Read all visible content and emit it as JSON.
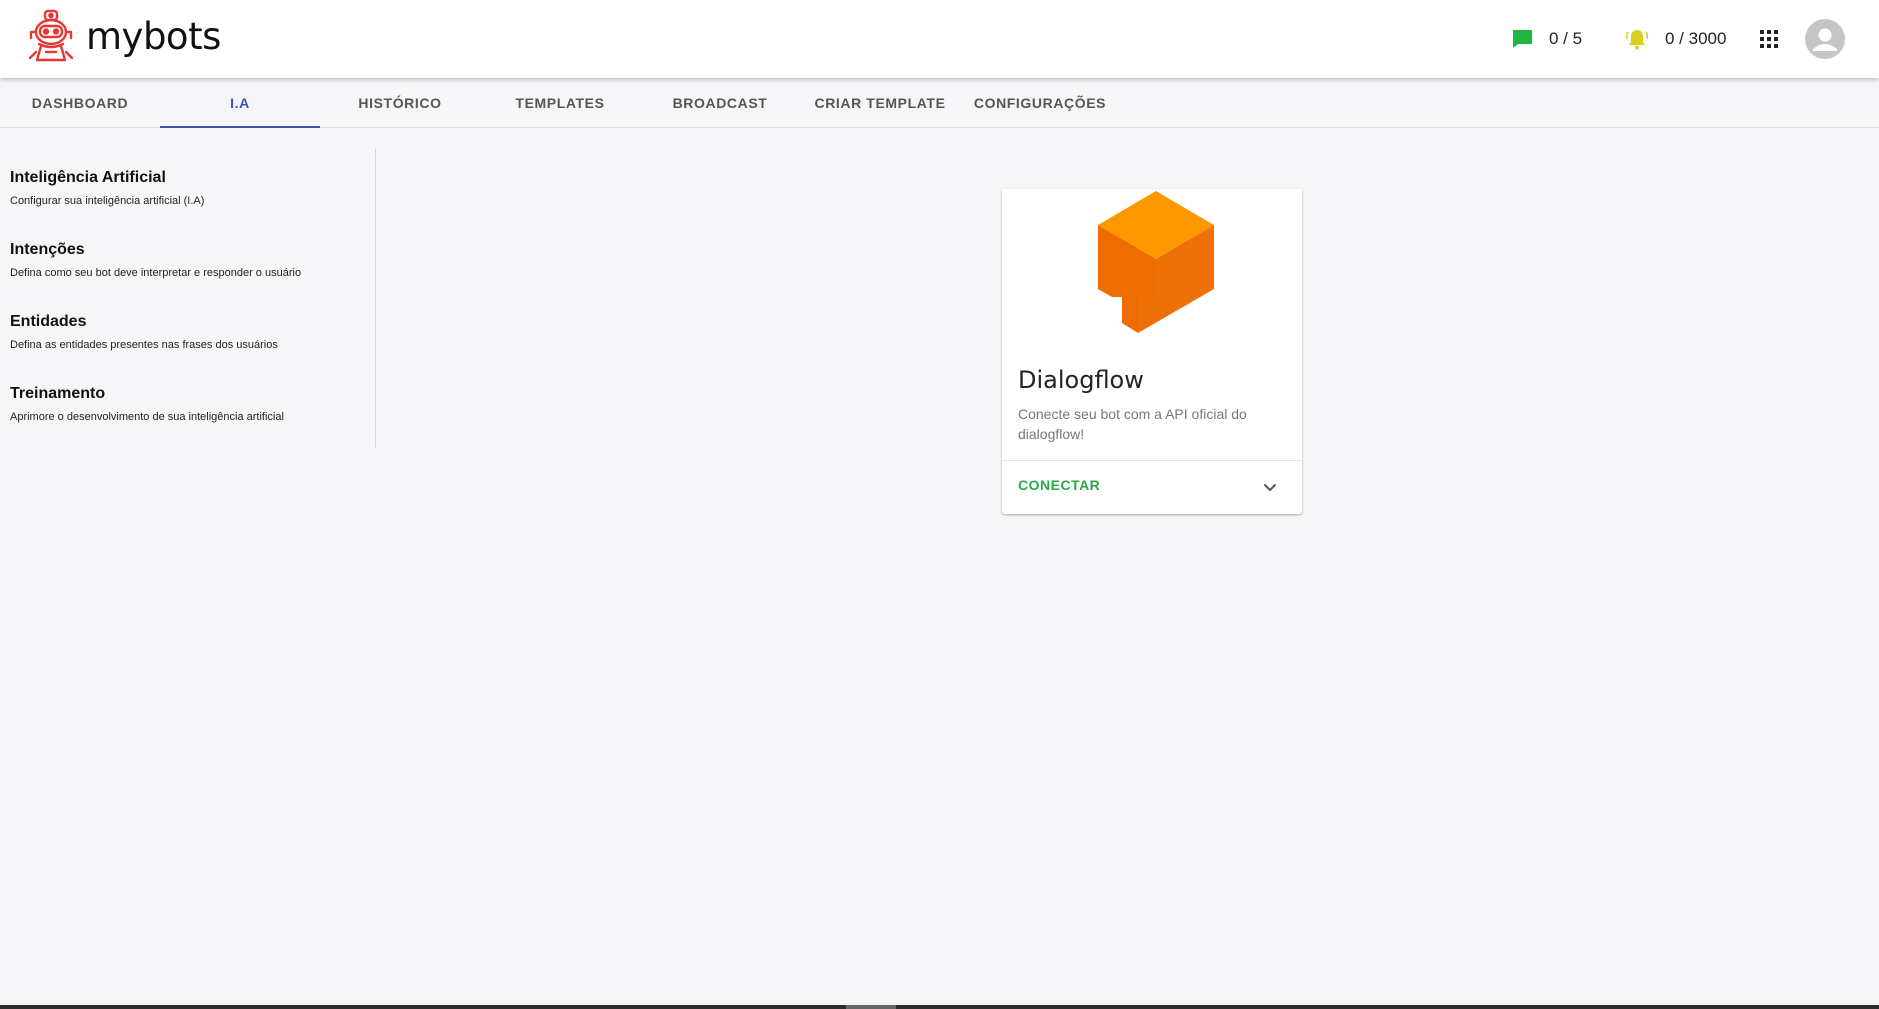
{
  "app": {
    "name": "mybots"
  },
  "header": {
    "messages_count": "0 / 5",
    "notifications_count": "0 / 3000",
    "colors": {
      "message_icon": "#1db840",
      "bell_icon": "#d6d11b"
    }
  },
  "tabs": [
    {
      "label": "DASHBOARD",
      "active": false
    },
    {
      "label": "I.A",
      "active": true
    },
    {
      "label": "HISTÓRICO",
      "active": false
    },
    {
      "label": "TEMPLATES",
      "active": false
    },
    {
      "label": "BROADCAST",
      "active": false
    },
    {
      "label": "CRIAR TEMPLATE",
      "active": false
    },
    {
      "label": "CONFIGURAÇÕES",
      "active": false
    }
  ],
  "sidebar": {
    "items": [
      {
        "title": "Inteligência Artificial",
        "description": "Configurar sua inteligência artificial (I.A)"
      },
      {
        "title": "Intenções",
        "description": "Defina como seu bot deve interpretar e responder o usuário"
      },
      {
        "title": "Entidades",
        "description": "Defina as entidades presentes nas frases dos usuários"
      },
      {
        "title": "Treinamento",
        "description": "Aprimore o desenvolvimento de sua inteligência artificial"
      }
    ]
  },
  "card": {
    "title": "Dialogflow",
    "description": "Conecte seu bot com a API oficial do dialogflow!",
    "action_label": "CONECTAR",
    "logo_icon": "dialogflow-logo",
    "colors": {
      "action": "#2aa84a",
      "logo_primary": "#ef6c00",
      "logo_top": "#ff9800"
    }
  },
  "theme": {
    "accent": "#3f51b5"
  }
}
